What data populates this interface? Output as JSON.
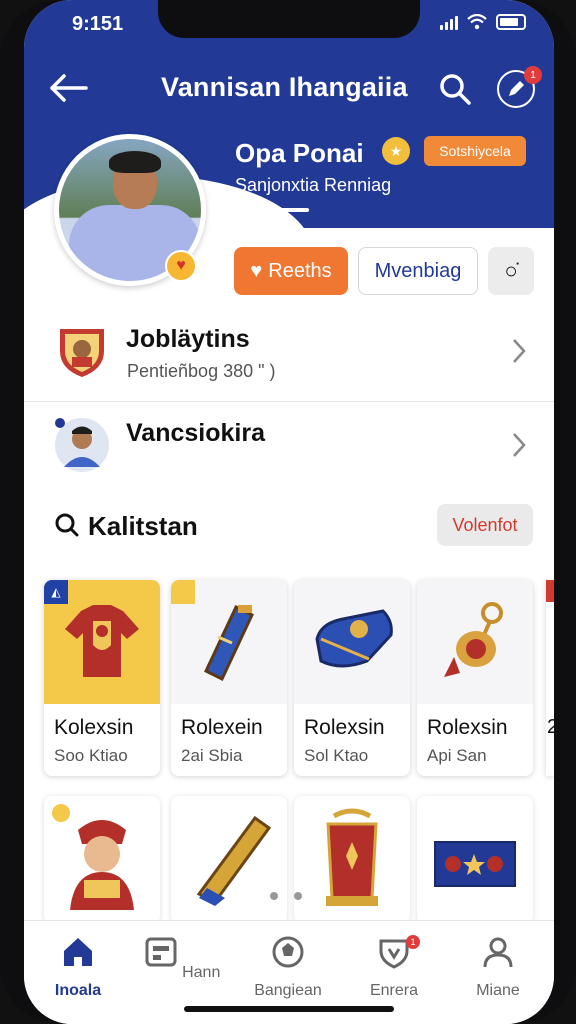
{
  "status_bar": {
    "time": "9:151"
  },
  "header": {
    "title": "Vannisan Ihangaiia",
    "notification_count": "1"
  },
  "profile": {
    "name": "Opa Ponai",
    "badge": "Sotshiycela",
    "subtitle": "Sanjonxtia Renniag"
  },
  "actions": {
    "primary_label": "Reeths",
    "secondary_label": "Mvenbiag",
    "icon_label": "○̇"
  },
  "list": [
    {
      "title": "Jobläytins",
      "subtitle": "Pentieñbog 380 \" )",
      "icon": "shield-icon"
    },
    {
      "title": "Vancsiokira",
      "subtitle": "",
      "icon": "player-avatar-icon"
    }
  ],
  "section": {
    "title": "Kalitstan",
    "action_label": "Volenfot"
  },
  "cards": [
    {
      "title": "Kolexsin",
      "subtitle": "Soo Ktiao",
      "icon": "jersey-icon"
    },
    {
      "title": "Rolexein",
      "subtitle": "2ai Sbia",
      "icon": "scarf-icon"
    },
    {
      "title": "Rolexsin",
      "subtitle": "Sol Ktao",
      "icon": "bag-icon"
    },
    {
      "title": "Rolexsin",
      "subtitle": "Api San",
      "icon": "keychain-icon"
    }
  ],
  "cards_row2": [
    {
      "icon": "mascot-icon"
    },
    {
      "icon": "scroll-icon"
    },
    {
      "icon": "trophy-icon"
    },
    {
      "icon": "flag-icon"
    }
  ],
  "partial_card_fragment": "2",
  "nav": [
    {
      "label": "Inoala",
      "icon": "home-icon",
      "active": true
    },
    {
      "label": "Hann",
      "icon": "news-icon"
    },
    {
      "label": "Bangiean",
      "icon": "ball-icon"
    },
    {
      "label": "Enrera",
      "icon": "badge-icon",
      "badge": "1"
    },
    {
      "label": "Miane",
      "icon": "profile-icon"
    }
  ],
  "colors": {
    "brand": "#223a96",
    "accent": "#f07732",
    "danger": "#d13b2f"
  }
}
